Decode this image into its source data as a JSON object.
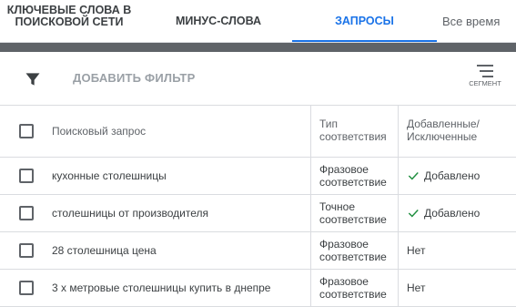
{
  "tabs": [
    {
      "label": "Ключевые слова в поисковой сети",
      "active": false
    },
    {
      "label": "Минус-слова",
      "active": false
    },
    {
      "label": "Запросы",
      "active": true
    },
    {
      "label": "Все время",
      "active": false
    }
  ],
  "toolbar": {
    "add_filter_label": "Добавить фильтр",
    "segment_label": "Сегмент"
  },
  "table": {
    "headers": {
      "query": "Поисковый запрос",
      "match_type": "Тип соответствия",
      "status": "Добавленные/ Исключенные"
    },
    "rows": [
      {
        "query": "кухонные столешницы",
        "match_type": "Фразовое соответствие",
        "status": "Добавлено",
        "added": true
      },
      {
        "query": "столешницы от производителя",
        "match_type": "Точное соответствие",
        "status": "Добавлено",
        "added": true
      },
      {
        "query": "28 столешница цена",
        "match_type": "Фразовое соответствие",
        "status": "Нет",
        "added": false
      },
      {
        "query": "3 х метровые столешницы купить в днепре",
        "match_type": "Фразовое соответствие",
        "status": "Нет",
        "added": false
      }
    ]
  },
  "colors": {
    "accent": "#1a73e8",
    "added_check": "#1e8e3e",
    "band": "#5f6368"
  }
}
